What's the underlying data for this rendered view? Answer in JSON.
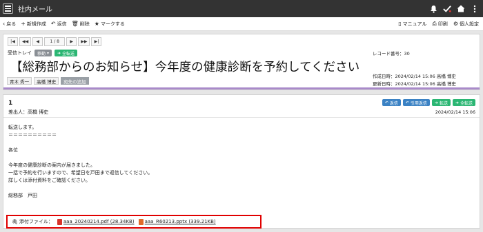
{
  "app": {
    "title": "社内メール"
  },
  "toolbar": {
    "back": "戻る",
    "new": "新規作成",
    "reply": "返信",
    "delete": "削除",
    "mark": "マークする",
    "manual": "マニュアル",
    "print": "印刷",
    "personal": "個人設定"
  },
  "pager": {
    "position": "1 / 8"
  },
  "tray": {
    "name": "受信トレイ",
    "move": "移動",
    "forward_all": "全転送"
  },
  "subject": "【総務部からのお知らせ】今年度の健康診断を予約してください",
  "record": {
    "number": "レコード番号：30"
  },
  "meta": {
    "created": "作成日時：2024/02/14 15:06 高橋 博史",
    "updated": "更新日時：2024/02/14 15:06 高橋 博史"
  },
  "recipients": [
    "青木 秀一",
    "高橋 博史"
  ],
  "add_recipient": "宛先の追加",
  "message": {
    "number": "1",
    "sender": "差出人：高橋 博史",
    "date": "2024/02/14 15:06",
    "buttons": {
      "reply": "返信",
      "quote_reply": "引用返信",
      "forward": "転送",
      "forward_all": "全転送"
    },
    "body": "転送します。\n＝＝＝＝＝＝＝＝＝＝\n\n各位\n\n今年度の健康診断の案内が届きました。\n一括で予約を行いますので、希望日を戸田まで返信してください。\n詳しくは添付資料をご確認ください。\n\n総務部　戸田"
  },
  "attachments": {
    "label": "添付ファイル：",
    "files": [
      {
        "name": "aaa_20240214.pdf (28.34KB)",
        "color": "#d9342b"
      },
      {
        "name": "aaa_R60213.pptx (339.21KB)",
        "color": "#e06a2b"
      }
    ]
  },
  "colors": {
    "header": "#333333",
    "accent": "#a98ac9",
    "green": "#2bb673",
    "blue": "#3b82c4",
    "highlight": "#e00000"
  }
}
